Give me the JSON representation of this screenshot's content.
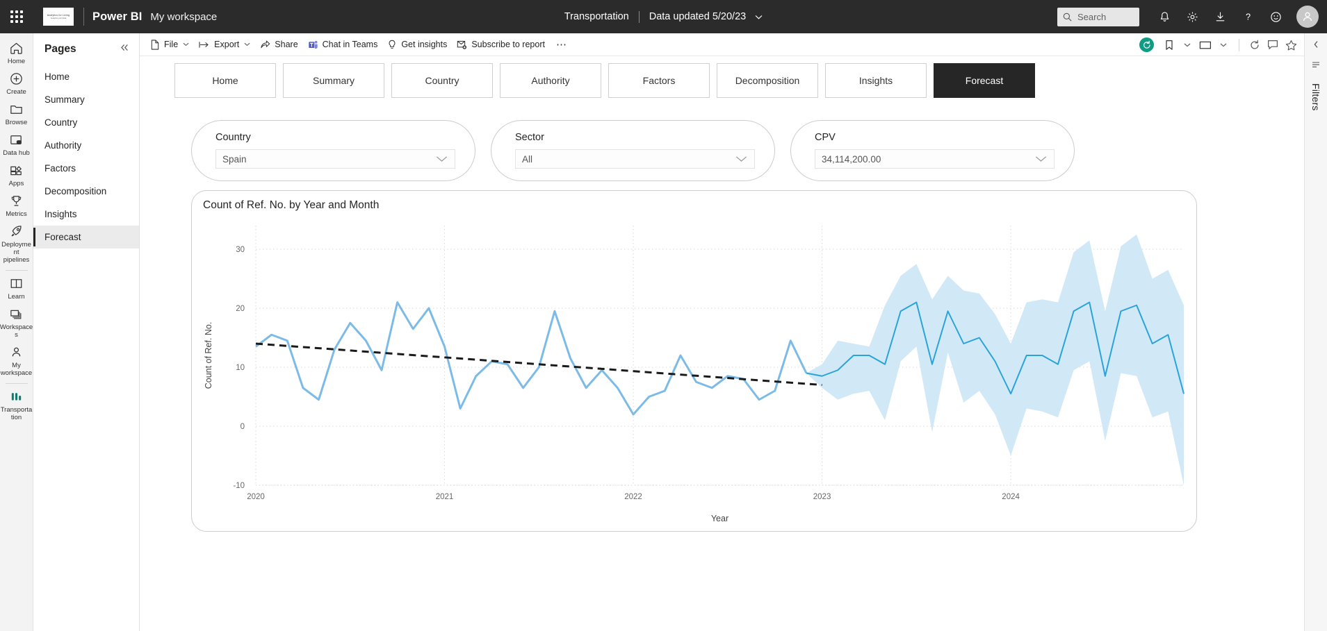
{
  "header": {
    "waffle_label": "App launcher",
    "brand_line1": "Analytics for Living",
    "brand_line2": "Analytics your Data",
    "app_title": "Power BI",
    "workspace": "My workspace",
    "report_name": "Transportation",
    "data_updated": "Data updated 5/20/23",
    "search_placeholder": "Search",
    "icons": [
      "bell-icon",
      "gear-icon",
      "download-icon",
      "help-icon",
      "feedback-icon",
      "avatar"
    ]
  },
  "rail": {
    "items": [
      {
        "label": "Home",
        "icon": "home-icon"
      },
      {
        "label": "Create",
        "icon": "plus-circle-icon"
      },
      {
        "label": "Browse",
        "icon": "folder-icon"
      },
      {
        "label": "Data hub",
        "icon": "data-hub-icon"
      },
      {
        "label": "Apps",
        "icon": "apps-icon"
      },
      {
        "label": "Metrics",
        "icon": "trophy-icon"
      },
      {
        "label": "Deployment pipelines",
        "icon": "rocket-icon"
      },
      {
        "label": "Learn",
        "icon": "book-icon"
      },
      {
        "label": "Workspaces",
        "icon": "workspaces-icon"
      },
      {
        "label": "My workspace",
        "icon": "person-icon"
      },
      {
        "label": "Transportation",
        "icon": "report-bars-icon"
      }
    ]
  },
  "pages_panel": {
    "title": "Pages",
    "collapse_icon": "double-chevron-left-icon",
    "items": [
      {
        "label": "Home",
        "selected": false
      },
      {
        "label": "Summary",
        "selected": false
      },
      {
        "label": "Country",
        "selected": false
      },
      {
        "label": "Authority",
        "selected": false
      },
      {
        "label": "Factors",
        "selected": false
      },
      {
        "label": "Decomposition",
        "selected": false
      },
      {
        "label": "Insights",
        "selected": false
      },
      {
        "label": "Forecast",
        "selected": true
      }
    ]
  },
  "toolbar": {
    "buttons": [
      {
        "label": "File",
        "icon": "file-icon",
        "chevron": true
      },
      {
        "label": "Export",
        "icon": "export-icon",
        "chevron": true
      },
      {
        "label": "Share",
        "icon": "share-icon",
        "chevron": false
      },
      {
        "label": "Chat in Teams",
        "icon": "teams-icon",
        "chevron": false
      },
      {
        "label": "Get insights",
        "icon": "lightbulb-icon",
        "chevron": false
      },
      {
        "label": "Subscribe to report",
        "icon": "subscribe-icon",
        "chevron": false
      }
    ],
    "more_label": "⋯",
    "right_icons": [
      "reset-icon",
      "bookmark-icon",
      "bookmark-chevron-icon",
      "view-icon",
      "view-chevron-icon",
      "refresh-icon",
      "comment-icon",
      "favorite-icon"
    ]
  },
  "filters_rail": {
    "label": "Filters",
    "collapse_icon": "chevron-left-icon",
    "expand_icon": "expand-icon"
  },
  "report": {
    "tabs": [
      {
        "label": "Home",
        "active": false
      },
      {
        "label": "Summary",
        "active": false
      },
      {
        "label": "Country",
        "active": false
      },
      {
        "label": "Authority",
        "active": false
      },
      {
        "label": "Factors",
        "active": false
      },
      {
        "label": "Decomposition",
        "active": false
      },
      {
        "label": "Insights",
        "active": false
      },
      {
        "label": "Forecast",
        "active": true
      }
    ],
    "slicers": [
      {
        "label": "Country",
        "value": "Spain",
        "chevron": "chevron-down-icon"
      },
      {
        "label": "Sector",
        "value": "All",
        "chevron": "chevron-down-icon"
      },
      {
        "label": "CPV",
        "value": "34,114,200.00",
        "chevron": "chevron-down-icon"
      }
    ]
  },
  "chart_data": {
    "type": "line",
    "title": "Count of Ref. No. by Year and Month",
    "xlabel": "Year",
    "ylabel": "Count of Ref. No.",
    "ylim": [
      -10,
      34
    ],
    "yticks": [
      -10,
      0,
      10,
      20,
      30
    ],
    "xticks": [
      "2020",
      "2021",
      "2022",
      "2023",
      "2024"
    ],
    "grid": true,
    "legend": "none",
    "colors": {
      "actual_line": "#7cbbe8",
      "forecast_line": "#29a3d9",
      "confidence_band": "#cfe8f7",
      "trend_line": "#1a1a1a",
      "gridline": "#d9d9d9",
      "axis_text": "#666666"
    },
    "x_start": "2020-01",
    "x_end": "2024-12",
    "forecast_start": "2022-12",
    "series": [
      {
        "name": "Count of Ref. No. (actual)",
        "type": "line",
        "x": [
          "2020-01",
          "2020-02",
          "2020-03",
          "2020-04",
          "2020-05",
          "2020-06",
          "2020-07",
          "2020-08",
          "2020-09",
          "2020-10",
          "2020-11",
          "2020-12",
          "2021-01",
          "2021-02",
          "2021-03",
          "2021-04",
          "2021-05",
          "2021-06",
          "2021-07",
          "2021-08",
          "2021-09",
          "2021-10",
          "2021-11",
          "2021-12",
          "2022-01",
          "2022-02",
          "2022-03",
          "2022-04",
          "2022-05",
          "2022-06",
          "2022-07",
          "2022-08",
          "2022-09",
          "2022-10",
          "2022-11",
          "2022-12"
        ],
        "values": [
          13.5,
          15.5,
          14.5,
          6.5,
          4.5,
          13.0,
          17.5,
          14.5,
          9.5,
          21.0,
          16.5,
          20.0,
          13.5,
          3.0,
          8.5,
          11.0,
          10.5,
          6.5,
          10.0,
          19.5,
          11.5,
          6.5,
          9.5,
          6.5,
          2.0,
          5.0,
          6.0,
          12.0,
          7.5,
          6.5,
          8.5,
          8.0,
          4.5,
          6.0,
          14.5,
          9.0
        ]
      },
      {
        "name": "Count of Ref. No. (forecast)",
        "type": "line",
        "x": [
          "2022-12",
          "2023-01",
          "2023-02",
          "2023-03",
          "2023-04",
          "2023-05",
          "2023-06",
          "2023-07",
          "2023-08",
          "2023-09",
          "2023-10",
          "2023-11",
          "2023-12",
          "2024-01",
          "2024-02",
          "2024-03",
          "2024-04",
          "2024-05",
          "2024-06",
          "2024-07",
          "2024-08",
          "2024-09",
          "2024-10",
          "2024-11",
          "2024-12"
        ],
        "values": [
          9.0,
          8.5,
          9.5,
          12.0,
          12.0,
          10.5,
          19.5,
          21.0,
          10.5,
          19.5,
          14.0,
          15.0,
          11.0,
          5.5,
          12.0,
          12.0,
          10.5,
          19.5,
          21.0,
          8.5,
          19.5,
          20.5,
          14.0,
          15.5,
          5.5
        ]
      }
    ],
    "confidence_band": {
      "name": "Forecast confidence interval",
      "x": [
        "2022-12",
        "2023-01",
        "2023-02",
        "2023-03",
        "2023-04",
        "2023-05",
        "2023-06",
        "2023-07",
        "2023-08",
        "2023-09",
        "2023-10",
        "2023-11",
        "2023-12",
        "2024-01",
        "2024-02",
        "2024-03",
        "2024-04",
        "2024-05",
        "2024-06",
        "2024-07",
        "2024-08",
        "2024-09",
        "2024-10",
        "2024-11",
        "2024-12"
      ],
      "upper": [
        9.0,
        10.5,
        14.5,
        14.0,
        13.5,
        20.5,
        25.5,
        27.5,
        21.5,
        25.5,
        23.0,
        22.5,
        19.0,
        14.0,
        21.0,
        21.5,
        21.0,
        29.5,
        31.5,
        19.5,
        30.5,
        32.5,
        25.0,
        26.5,
        20.5
      ],
      "lower": [
        9.0,
        6.5,
        4.5,
        5.5,
        6.0,
        1.0,
        11.0,
        13.5,
        -1.0,
        12.5,
        4.0,
        6.0,
        2.0,
        -5.0,
        3.0,
        2.5,
        1.5,
        9.5,
        11.0,
        -2.5,
        9.0,
        8.5,
        1.5,
        2.5,
        -10.0
      ]
    },
    "trend_line": {
      "name": "Trend",
      "style": "dashed",
      "x": [
        "2020-01",
        "2023-01"
      ],
      "values": [
        14.0,
        7.0
      ]
    }
  }
}
